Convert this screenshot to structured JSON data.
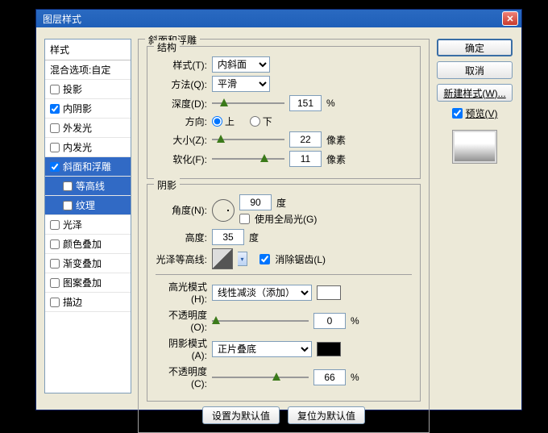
{
  "title": "图层样式",
  "styles": {
    "header": "样式",
    "blend": "混合选项:自定",
    "items": [
      {
        "label": "投影",
        "checked": false,
        "sel": false
      },
      {
        "label": "内阴影",
        "checked": true,
        "sel": false
      },
      {
        "label": "外发光",
        "checked": false,
        "sel": false
      },
      {
        "label": "内发光",
        "checked": false,
        "sel": false
      },
      {
        "label": "斜面和浮雕",
        "checked": true,
        "sel": true
      },
      {
        "label": "等高线",
        "checked": false,
        "sel": true,
        "sub": true
      },
      {
        "label": "纹理",
        "checked": false,
        "sel": true,
        "sub": true
      },
      {
        "label": "光泽",
        "checked": false,
        "sel": false
      },
      {
        "label": "颜色叠加",
        "checked": false,
        "sel": false
      },
      {
        "label": "渐变叠加",
        "checked": false,
        "sel": false
      },
      {
        "label": "图案叠加",
        "checked": false,
        "sel": false
      },
      {
        "label": "描边",
        "checked": false,
        "sel": false
      }
    ]
  },
  "group": "斜面和浮雕",
  "struct": {
    "legend": "结构",
    "style_lbl": "样式(T):",
    "style_val": "内斜面",
    "method_lbl": "方法(Q):",
    "method_val": "平滑",
    "depth_lbl": "深度(D):",
    "depth_val": "151",
    "depth_unit": "%",
    "dir_lbl": "方向:",
    "dir_up": "上",
    "dir_down": "下",
    "size_lbl": "大小(Z):",
    "size_val": "22",
    "size_unit": "像素",
    "soft_lbl": "软化(F):",
    "soft_val": "11",
    "soft_unit": "像素"
  },
  "shade": {
    "legend": "阴影",
    "angle_lbl": "角度(N):",
    "angle_val": "90",
    "angle_unit": "度",
    "global": "使用全局光(G)",
    "alt_lbl": "高度:",
    "alt_val": "35",
    "alt_unit": "度",
    "gloss_lbl": "光泽等高线:",
    "anti": "消除锯齿(L)",
    "hi_mode_lbl": "高光模式(H):",
    "hi_mode_val": "线性减淡（添加）",
    "hi_color": "#ffffff",
    "hi_op_lbl": "不透明度(O):",
    "hi_op_val": "0",
    "hi_op_unit": "%",
    "sh_mode_lbl": "阴影模式(A):",
    "sh_mode_val": "正片叠底",
    "sh_color": "#000000",
    "sh_op_lbl": "不透明度(C):",
    "sh_op_val": "66",
    "sh_op_unit": "%"
  },
  "bot": {
    "def": "设置为默认值",
    "reset": "复位为默认值"
  },
  "right": {
    "ok": "确定",
    "cancel": "取消",
    "new": "新建样式(W)...",
    "preview": "预览(V)"
  }
}
